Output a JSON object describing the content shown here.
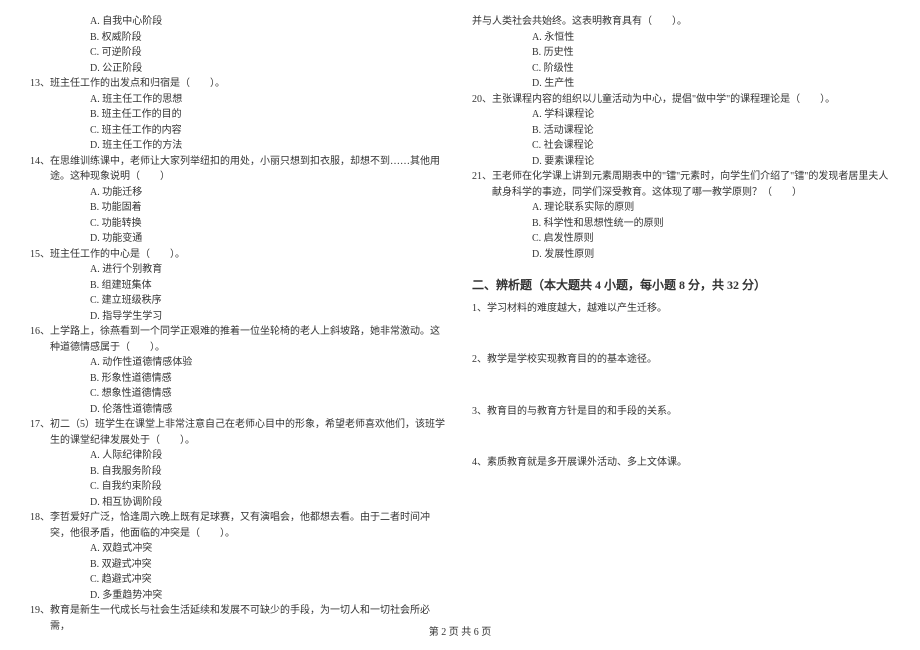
{
  "left": {
    "q12_options": [
      "A. 自我中心阶段",
      "B. 权威阶段",
      "C. 可逆阶段",
      "D. 公正阶段"
    ],
    "q13": "13、班主任工作的出发点和归宿是（　　）。",
    "q13_options": [
      "A. 班主任工作的思想",
      "B. 班主任工作的目的",
      "C. 班主任工作的内容",
      "D. 班主任工作的方法"
    ],
    "q14": "14、在思维训练课中，老师让大家列举纽扣的用处，小丽只想到扣衣服，却想不到……其他用途。这种现象说明（　　）",
    "q14_options": [
      "A. 功能迁移",
      "B. 功能固着",
      "C. 功能转换",
      "D. 功能变通"
    ],
    "q15": "15、班主任工作的中心是（　　）。",
    "q15_options": [
      "A. 进行个别教育",
      "B. 组建班集体",
      "C. 建立班级秩序",
      "D. 指导学生学习"
    ],
    "q16": "16、上学路上，徐燕看到一个同学正艰难的推着一位坐轮椅的老人上斜坡路，她非常激动。这种道德情感属于（　　）。",
    "q16_options": [
      "A. 动作性道德情感体验",
      "B. 形象性道德情感",
      "C. 想象性道德情感",
      "D. 伦落性道德情感"
    ],
    "q17": "17、初二（5）班学生在课堂上非常注意自己在老师心目中的形象，希望老师喜欢他们，该班学生的课堂纪律发展处于（　　）。",
    "q17_options": [
      "A. 人际纪律阶段",
      "B. 自我服务阶段",
      "C. 自我约束阶段",
      "D. 相互协调阶段"
    ],
    "q18": "18、李哲爱好广泛，恰逢周六晚上既有足球赛，又有演唱会，他都想去看。由于二者时间冲突，他很矛盾，他面临的冲突是（　　）。",
    "q18_options": [
      "A. 双趋式冲突",
      "B. 双避式冲突",
      "C. 趋避式冲突",
      "D. 多重趋势冲突"
    ],
    "q19": "19、教育是新生一代成长与社会生活延续和发展不可缺少的手段，为一切人和一切社会所必需，"
  },
  "right": {
    "q19_cont": "并与人类社会共始终。这表明教育具有（　　）。",
    "q19_options": [
      "A. 永恒性",
      "B. 历史性",
      "C. 阶级性",
      "D. 生产性"
    ],
    "q20": "20、主张课程内容的组织以儿童活动为中心，提倡\"做中学\"的课程理论是（　　）。",
    "q20_options": [
      "A. 学科课程论",
      "B. 活动课程论",
      "C. 社会课程论",
      "D. 要素课程论"
    ],
    "q21": "21、王老师在化学课上讲到元素周期表中的\"镭\"元素时，向学生们介绍了\"镭\"的发现者居里夫人献身科学的事迹，同学们深受教育。这体现了哪一教学原则？（　　）",
    "q21_options": [
      "A. 理论联系实际的原则",
      "B. 科学性和思想性统一的原则",
      "C. 启发性原则",
      "D. 发展性原则"
    ],
    "section2_heading": "二、辨析题（本大题共 4 小题，每小题 8 分，共 32 分）",
    "a1": "1、学习材料的难度越大，越难以产生迁移。",
    "a2": "2、教学是学校实现教育目的的基本途径。",
    "a3": "3、教育目的与教育方针是目的和手段的关系。",
    "a4": "4、素质教育就是多开展课外活动、多上文体课。"
  },
  "footer": "第 2 页 共 6 页"
}
